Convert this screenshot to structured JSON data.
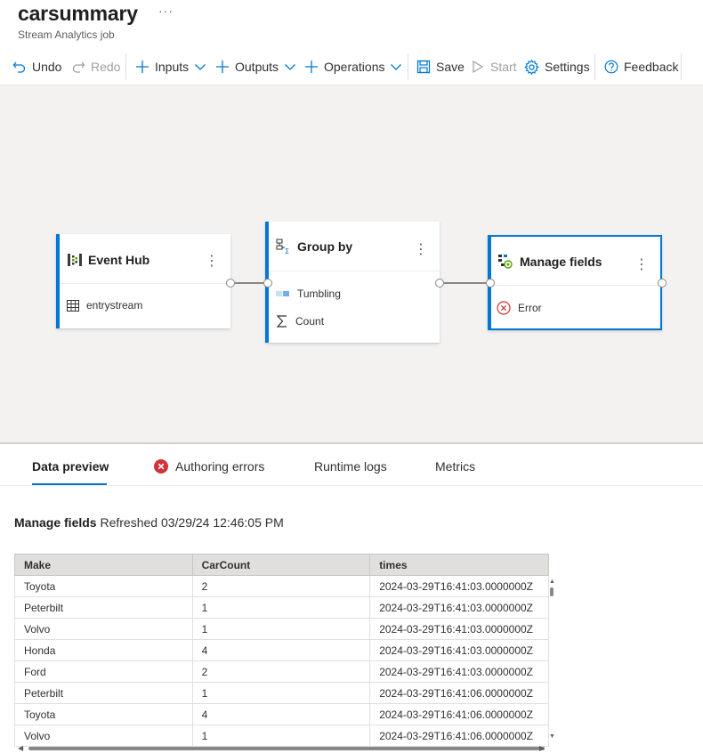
{
  "header": {
    "title": "carsummary",
    "more": "···",
    "subtitle": "Stream Analytics job"
  },
  "toolbar": {
    "undo": "Undo",
    "redo": "Redo",
    "inputs": "Inputs",
    "outputs": "Outputs",
    "operations": "Operations",
    "save": "Save",
    "start": "Start",
    "settings": "Settings",
    "feedback": "Feedback"
  },
  "nodes": {
    "event_hub": {
      "title": "Event Hub",
      "row": "entrystream"
    },
    "group_by": {
      "title": "Group by",
      "row1": "Tumbling",
      "row2": "Count"
    },
    "manage_fields": {
      "title": "Manage fields",
      "row": "Error"
    }
  },
  "tabs": {
    "data_preview": "Data preview",
    "authoring_errors": "Authoring errors",
    "runtime_logs": "Runtime logs",
    "metrics": "Metrics"
  },
  "preview": {
    "source": "Manage fields",
    "refreshed": "Refreshed 03/29/24 12:46:05 PM"
  },
  "table": {
    "columns": [
      "Make",
      "CarCount",
      "times"
    ],
    "rows": [
      [
        "Toyota",
        "2",
        "2024-03-29T16:41:03.0000000Z"
      ],
      [
        "Peterbilt",
        "1",
        "2024-03-29T16:41:03.0000000Z"
      ],
      [
        "Volvo",
        "1",
        "2024-03-29T16:41:03.0000000Z"
      ],
      [
        "Honda",
        "4",
        "2024-03-29T16:41:03.0000000Z"
      ],
      [
        "Ford",
        "2",
        "2024-03-29T16:41:03.0000000Z"
      ],
      [
        "Peterbilt",
        "1",
        "2024-03-29T16:41:06.0000000Z"
      ],
      [
        "Toyota",
        "4",
        "2024-03-29T16:41:06.0000000Z"
      ],
      [
        "Volvo",
        "1",
        "2024-03-29T16:41:06.0000000Z"
      ]
    ]
  },
  "colors": {
    "accent": "#0078d4",
    "error": "#d13438"
  }
}
